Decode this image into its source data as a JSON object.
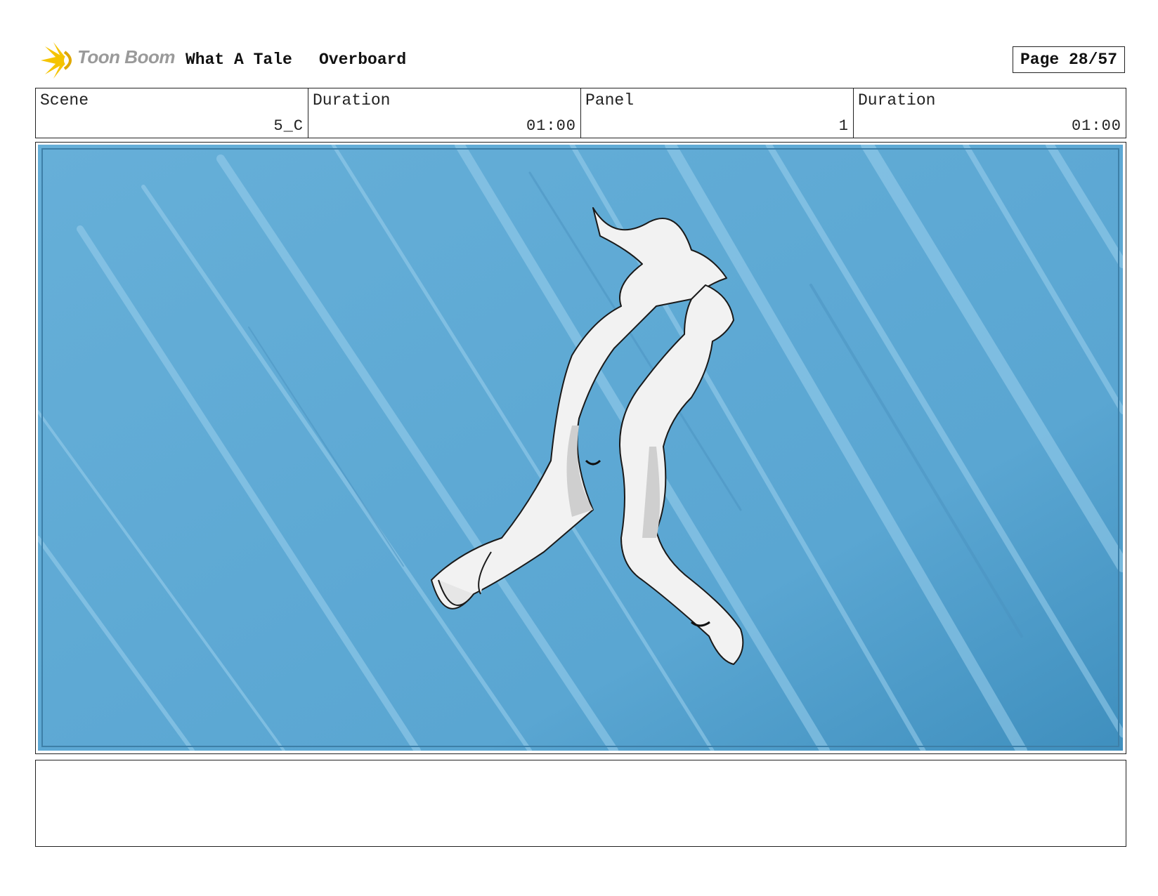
{
  "header": {
    "brand": "Toon Boom",
    "project": "What A Tale",
    "sequence": "Overboard",
    "page": "Page 28/57"
  },
  "info": {
    "scene_label": "Scene",
    "scene_value": "5_C",
    "scene_duration_label": "Duration",
    "scene_duration_value": "01:00",
    "panel_label": "Panel",
    "panel_value": "1",
    "panel_duration_label": "Duration",
    "panel_duration_value": "01:00"
  },
  "panel_image": {
    "description_icon": "underwater-couple-sketch",
    "colors": {
      "water": "#5fa9d4",
      "light": "#bfe7f5",
      "streak": "#8cc6e6",
      "figure": "#f2f2f2"
    }
  },
  "notes": {
    "text": ""
  }
}
